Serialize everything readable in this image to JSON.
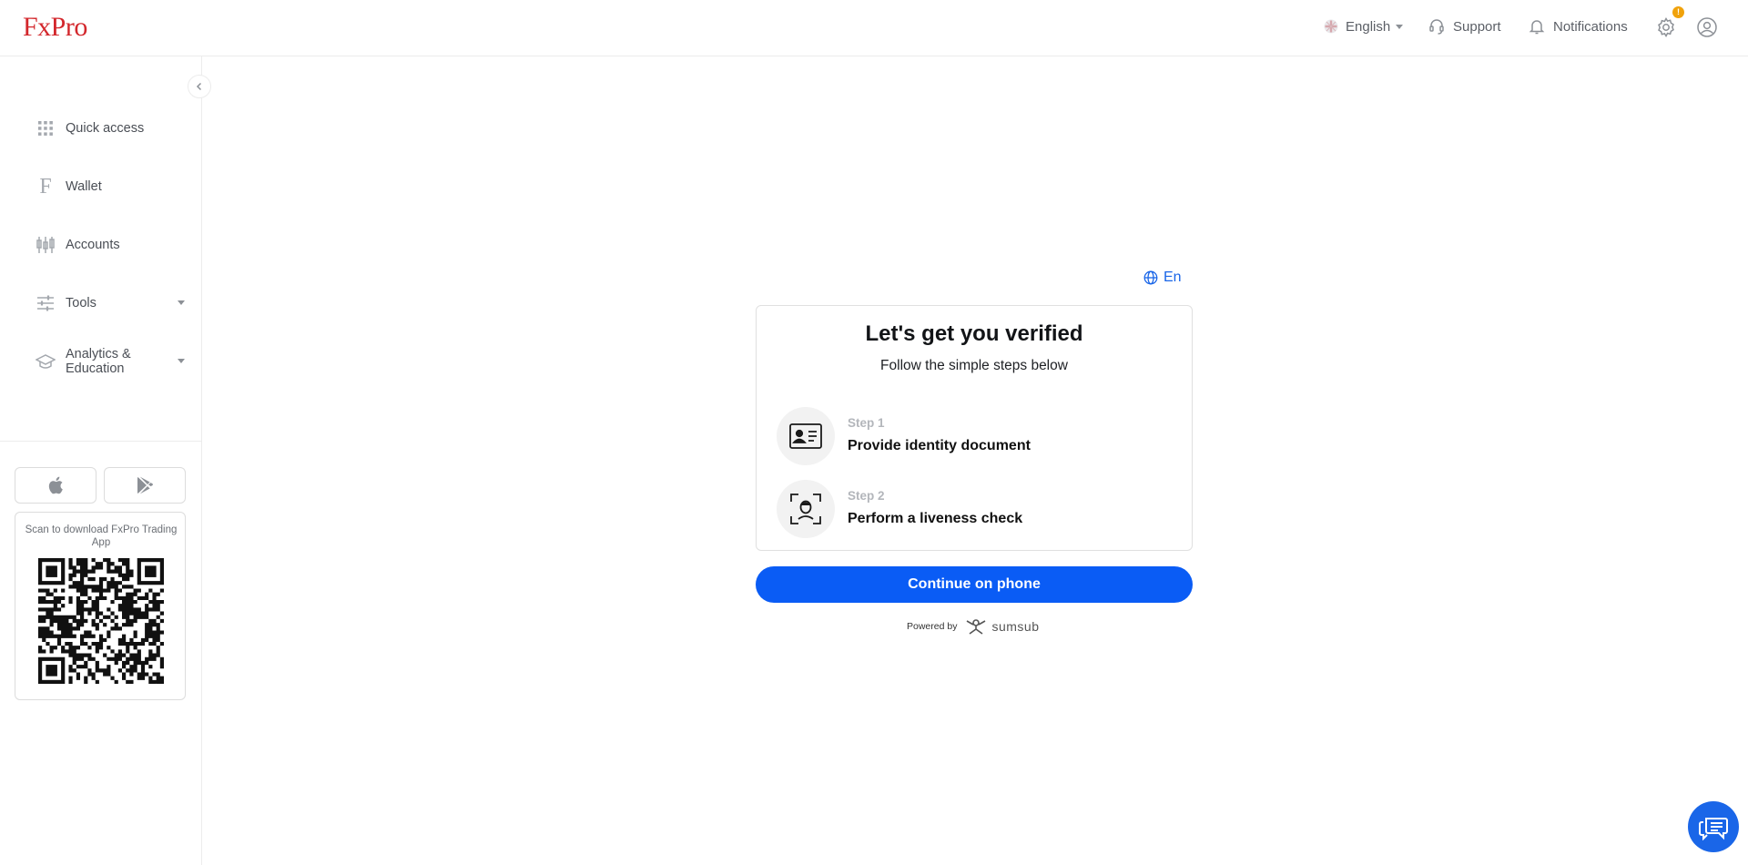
{
  "header": {
    "logo": "FxPro",
    "language": "English",
    "support": "Support",
    "notifications": "Notifications",
    "settings_badge": "!"
  },
  "sidebar": {
    "items": [
      {
        "label": "Quick access",
        "icon": "grid-icon"
      },
      {
        "label": "Wallet",
        "icon": "fxpro-f-icon"
      },
      {
        "label": "Accounts",
        "icon": "candles-icon"
      },
      {
        "label": "Tools",
        "icon": "sliders-icon",
        "expandable": true
      },
      {
        "label": "Analytics & Education",
        "icon": "graduation-cap-icon",
        "expandable": true
      }
    ],
    "qr_text": "Scan to download FxPro Trading App"
  },
  "verification": {
    "language_short": "En",
    "title": "Let's get you verified",
    "subtitle": "Follow the simple steps below",
    "steps": [
      {
        "number": "Step 1",
        "label": "Provide identity document",
        "icon": "id-card-icon"
      },
      {
        "number": "Step 2",
        "label": "Perform a liveness check",
        "icon": "face-scan-icon"
      }
    ],
    "cta": "Continue on phone",
    "powered_by": "Powered by",
    "powered_brand": "sumsub"
  },
  "colors": {
    "brand_red": "#d3272c",
    "primary_blue": "#0a5cf5",
    "badge_orange": "#f0a20b"
  }
}
